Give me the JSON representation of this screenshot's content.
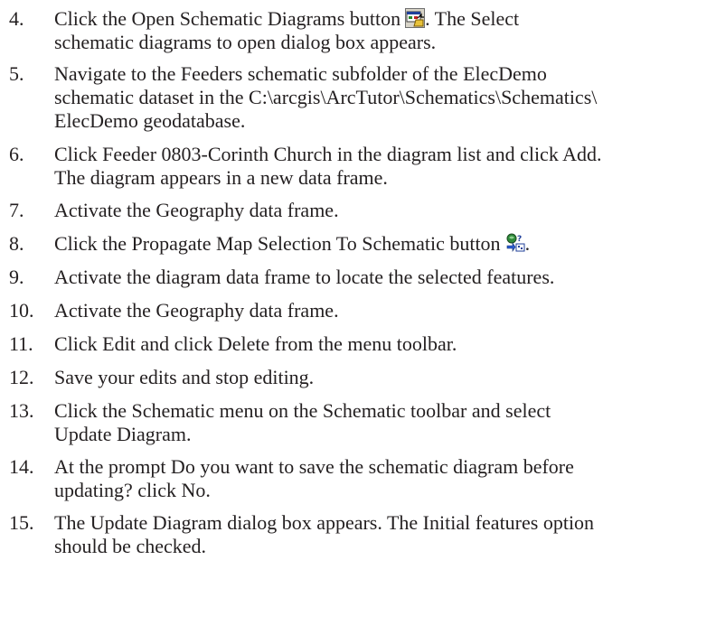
{
  "steps": [
    {
      "number": "4.",
      "line1_before": "Click the Open Schematic Diagrams button",
      "line1_after": ". The Select",
      "line2": "schematic diagrams to open dialog box appears.",
      "icon": "open-schematic-diagrams-icon"
    },
    {
      "number": "5.",
      "line1": "Navigate to the Feeders schematic subfolder of the ElecDemo",
      "line2": "schematic dataset in the C:\\arcgis\\ArcTutor\\Schematics\\Schematics\\",
      "line3": "ElecDemo geodatabase."
    },
    {
      "number": "6.",
      "line1": "Click Feeder 0803-Corinth Church in the diagram list and click Add.",
      "line2": "The diagram appears in a new data frame."
    },
    {
      "number": "7.",
      "line1": "Activate the Geography data frame."
    },
    {
      "number": "8.",
      "line1_before": "Click the Propagate Map Selection To Schematic button",
      "line1_after": ".",
      "icon": "propagate-map-selection-icon"
    },
    {
      "number": "9.",
      "line1": "Activate the diagram data frame to locate the selected features."
    },
    {
      "number": "10.",
      "line1": "Activate the Geography data frame."
    },
    {
      "number": "11.",
      "line1": "Click Edit and click Delete from the menu toolbar."
    },
    {
      "number": "12.",
      "line1": "Save your edits and stop editing."
    },
    {
      "number": "13.",
      "line1": "Click the Schematic menu on the Schematic toolbar and select",
      "line2": "Update Diagram."
    },
    {
      "number": "14.",
      "line1": "At the prompt Do you want to save the schematic diagram before",
      "line2": "updating? click No."
    },
    {
      "number": "15.",
      "line1": "The Update Diagram dialog box appears. The Initial features option",
      "line2": "should be checked."
    }
  ]
}
